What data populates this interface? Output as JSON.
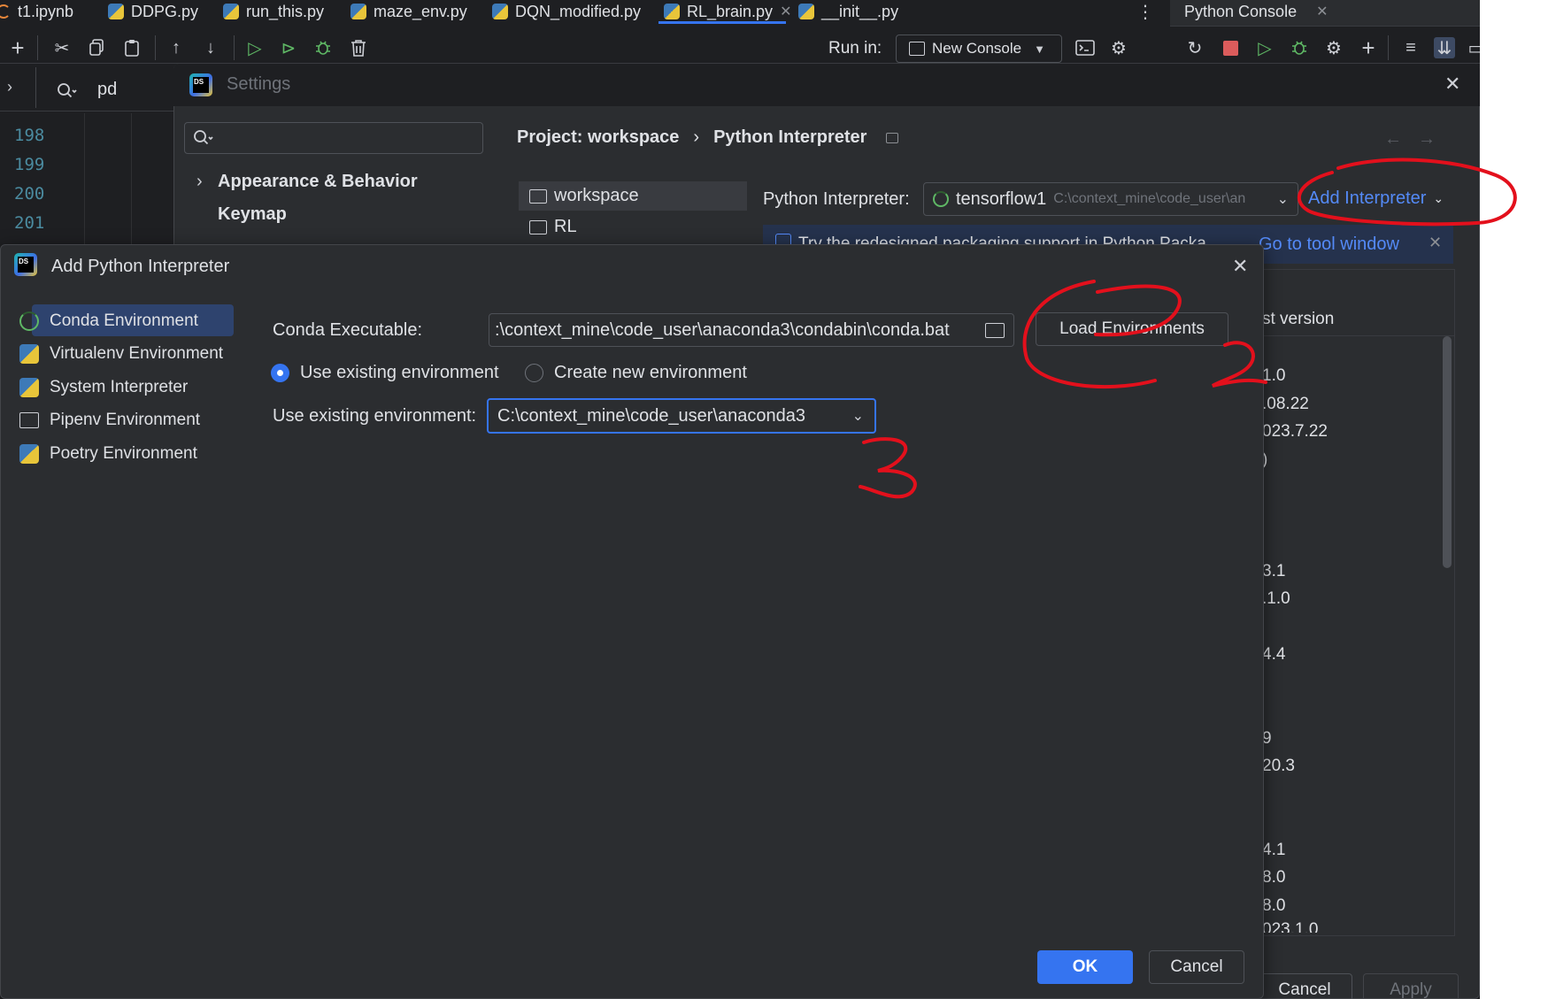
{
  "editor_tabs": [
    {
      "label": "t1.ipynb"
    },
    {
      "label": "DDPG.py"
    },
    {
      "label": "run_this.py"
    },
    {
      "label": "maze_env.py"
    },
    {
      "label": "DQN_modified.py"
    },
    {
      "label": "RL_brain.py"
    },
    {
      "label": "__init__.py"
    }
  ],
  "console_tab": {
    "label": "Python Console"
  },
  "toolbar": {
    "run_in_label": "Run in:",
    "new_console_label": "New Console"
  },
  "search": {
    "value": "pd"
  },
  "line_numbers": [
    "198",
    "199",
    "200",
    "201"
  ],
  "settings": {
    "title": "Settings",
    "breadcrumb_project": "Project: workspace",
    "breadcrumb_sep": "›",
    "breadcrumb_page": "Python Interpreter",
    "tree": [
      {
        "label": "Appearance & Behavior"
      },
      {
        "label": "Keymap"
      }
    ],
    "projects": [
      {
        "label": "workspace"
      },
      {
        "label": "RL"
      }
    ],
    "interpreter_label": "Python Interpreter:",
    "interpreter_name": "tensorflow1",
    "interpreter_path": "C:\\context_mine\\code_user\\an",
    "add_interpreter": "Add Interpreter",
    "banner_text": "Try the redesigned packaging support in Python Packa",
    "banner_link": "Go to tool window",
    "col_latest_version": "st version",
    "versions": [
      "1.0",
      ".08.22",
      "023.7.22",
      ")",
      "",
      "",
      "",
      "3.1",
      ".1.0",
      "",
      "4.4",
      "",
      "",
      "9",
      "20.3",
      "",
      "",
      "4.1",
      "8.0",
      "8.0",
      "023.1.0"
    ],
    "cancel": "Cancel",
    "apply": "Apply"
  },
  "dialog": {
    "title": "Add Python Interpreter",
    "env_types": [
      {
        "label": "Conda Environment"
      },
      {
        "label": "Virtualenv Environment"
      },
      {
        "label": "System Interpreter"
      },
      {
        "label": "Pipenv Environment"
      },
      {
        "label": "Poetry Environment"
      }
    ],
    "conda_exec_label": "Conda Executable:",
    "conda_exec_value": ":\\context_mine\\code_user\\anaconda3\\condabin\\conda.bat",
    "load_envs": "Load Environments",
    "radio_existing": "Use existing environment",
    "radio_new": "Create new environment",
    "existing_label": "Use existing environment:",
    "existing_value": "C:\\context_mine\\code_user\\anaconda3",
    "ok": "OK",
    "cancel": "Cancel"
  },
  "annotations": {
    "one": "1",
    "two": "2",
    "three": "3"
  },
  "colors": {
    "bg": "#1e1f22",
    "panel": "#2b2d30",
    "accent": "#3574f0",
    "link": "#548af7",
    "annotation": "#e3101c",
    "run_green": "#5fb865",
    "stop_red": "#db5c5c"
  }
}
